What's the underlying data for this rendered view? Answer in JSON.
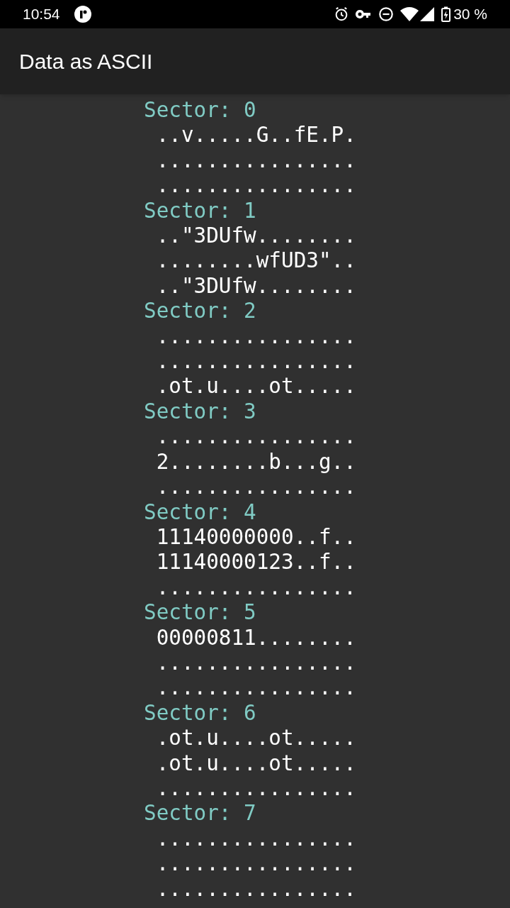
{
  "status_bar": {
    "time": "10:54",
    "battery": "30 %"
  },
  "app_bar": {
    "title": "Data as ASCII"
  },
  "sectors": [
    {
      "label": "Sector: 0",
      "lines": [
        "..v.....G..fE.P.",
        "................",
        "................"
      ]
    },
    {
      "label": "Sector: 1",
      "lines": [
        "..\"3DUfw........",
        "........wfUD3\"..",
        "..\"3DUfw........"
      ]
    },
    {
      "label": "Sector: 2",
      "lines": [
        "................",
        "................",
        ".ot.u....ot....."
      ]
    },
    {
      "label": "Sector: 3",
      "lines": [
        "................",
        "2........b...g..",
        "................"
      ]
    },
    {
      "label": "Sector: 4",
      "lines": [
        "11140000000..f..",
        "11140000123..f..",
        "................"
      ]
    },
    {
      "label": "Sector: 5",
      "lines": [
        "00000811........",
        "................",
        "................"
      ]
    },
    {
      "label": "Sector: 6",
      "lines": [
        ".ot.u....ot.....",
        ".ot.u....ot.....",
        "................"
      ]
    },
    {
      "label": "Sector: 7",
      "lines": [
        "................",
        "................",
        "................"
      ]
    }
  ]
}
